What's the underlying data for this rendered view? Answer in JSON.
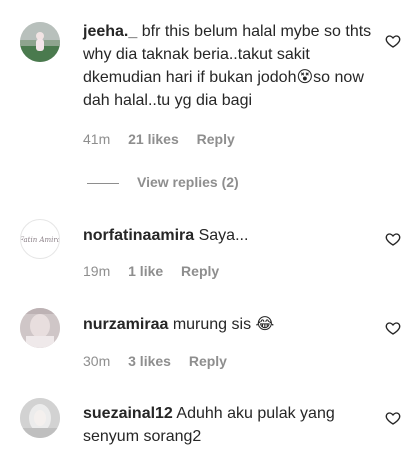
{
  "comments": [
    {
      "username": "jeeha._",
      "text": "bfr this belum halal mybe so thts why dia taknak beria..takut sakit dkemudian hari if bukan jodoh",
      "emoji": "😵",
      "text_after": "so now dah halal..tu yg dia bagi",
      "time": "41m",
      "likes": "21 likes",
      "reply": "Reply",
      "view_replies": "View replies (2)"
    },
    {
      "username": "norfatinaamira",
      "text": "Saya...",
      "time": "19m",
      "likes": "1 like",
      "reply": "Reply",
      "avatar_text": "Fatin Amira"
    },
    {
      "username": "nurzamiraa",
      "text": "murung sis",
      "emoji": "😂",
      "time": "30m",
      "likes": "3 likes",
      "reply": "Reply"
    },
    {
      "username": "suezainal12",
      "text": "Aduhh aku pulak yang senyum sorang2"
    }
  ],
  "colors": {
    "text": "#262626",
    "meta": "#8e8e8e"
  }
}
